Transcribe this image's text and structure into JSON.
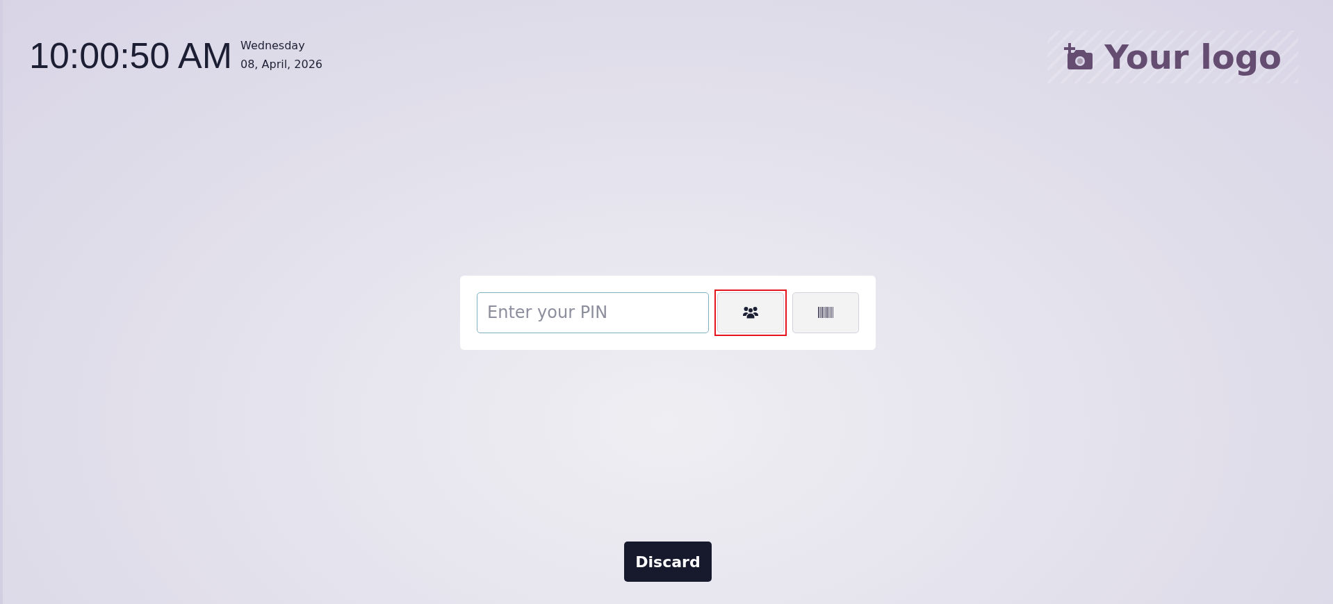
{
  "clock": {
    "time": "10:00:50 AM",
    "weekday": "Wednesday",
    "date": "08, April, 2026"
  },
  "logo": {
    "text": "Your logo"
  },
  "pin_form": {
    "placeholder": "Enter your PIN",
    "buttons": [
      {
        "kind": "employees",
        "highlighted": true
      },
      {
        "kind": "barcode",
        "highlighted": false
      }
    ]
  },
  "footer": {
    "button": "Discard"
  }
}
